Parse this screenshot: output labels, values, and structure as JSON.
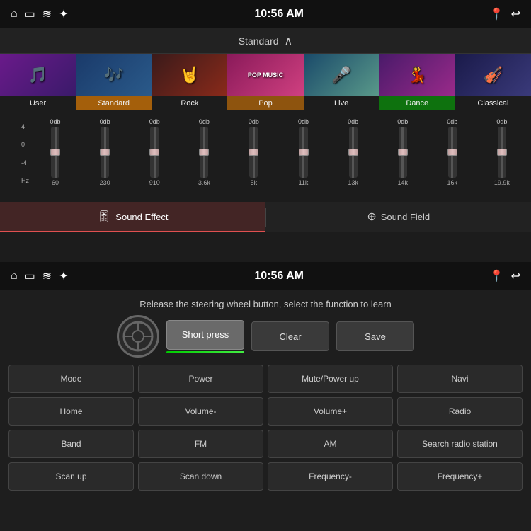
{
  "top_status": {
    "time": "10:56 AM",
    "icons": [
      "⌂",
      "▭",
      "≋",
      "✦"
    ]
  },
  "bottom_status": {
    "time": "10:56 AM"
  },
  "eq": {
    "mode_label": "Standard",
    "presets": [
      {
        "label": "User",
        "active": false,
        "thumb_class": "preset-thumb-user"
      },
      {
        "label": "Standard",
        "active": true,
        "thumb_class": "preset-thumb-standard"
      },
      {
        "label": "Rock",
        "active": false,
        "thumb_class": "preset-thumb-rock"
      },
      {
        "label": "Pop",
        "active": false,
        "thumb_class": "preset-thumb-pop"
      },
      {
        "label": "Live",
        "active": false,
        "thumb_class": "preset-thumb-live"
      },
      {
        "label": "Dance",
        "active": false,
        "thumb_class": "preset-thumb-dance"
      },
      {
        "label": "Classical",
        "active": false,
        "thumb_class": "preset-thumb-classical"
      }
    ],
    "bands": [
      {
        "db": "0db",
        "freq": "60"
      },
      {
        "db": "0db",
        "freq": "230"
      },
      {
        "db": "0db",
        "freq": "910"
      },
      {
        "db": "0db",
        "freq": "3.6k"
      },
      {
        "db": "0db",
        "freq": "5k"
      },
      {
        "db": "0db",
        "freq": "11k"
      },
      {
        "db": "0db",
        "freq": "13k"
      },
      {
        "db": "0db",
        "freq": "14k"
      },
      {
        "db": "0db",
        "freq": "16k"
      },
      {
        "db": "0db",
        "freq": "19.9k"
      }
    ],
    "db_scale": [
      "4",
      "0",
      "-4",
      "Hz"
    ],
    "sound_effect_label": "Sound Effect",
    "sound_field_label": "Sound Field"
  },
  "steering": {
    "instruction": "Release the steering wheel button, select the function to learn",
    "buttons": {
      "short_press": "Short press",
      "clear": "Clear",
      "save": "Save"
    },
    "functions": [
      "Mode",
      "Power",
      "Mute/Power up",
      "Navi",
      "Home",
      "Volume-",
      "Volume+",
      "Radio",
      "Band",
      "FM",
      "AM",
      "Search radio station",
      "Scan up",
      "Scan down",
      "Frequency-",
      "Frequency+"
    ]
  }
}
